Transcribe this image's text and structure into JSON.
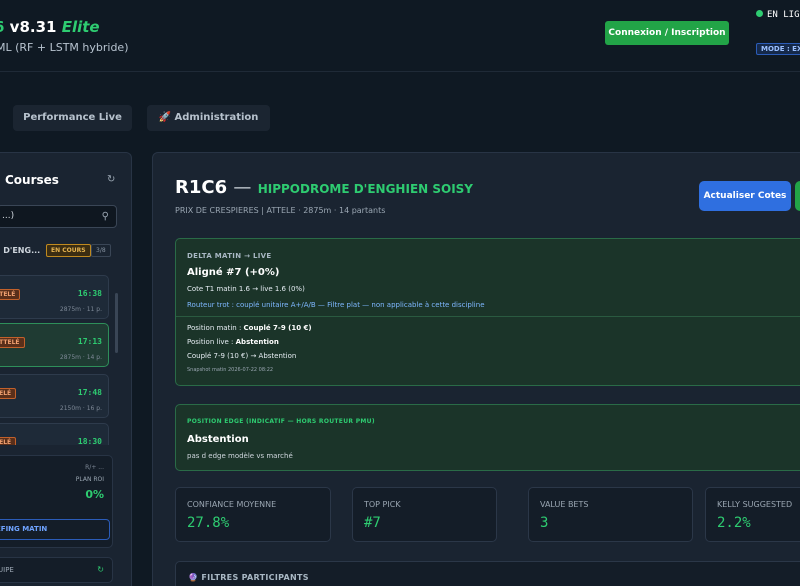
{
  "header": {
    "brand_prefix": "6",
    "version": "v8.31",
    "edition": "Elite",
    "subtitle": "ML (RF + LSTM hybride)",
    "login_label": "Connexion / Inscription",
    "status_label": "EN LIG",
    "mode_label": "MODE : EX",
    "status_color": "#2ecc71"
  },
  "tabs": [
    {
      "label": "Performance Live"
    },
    {
      "label": "🚀 Administration"
    }
  ],
  "sidebar": {
    "title": "Courses",
    "search_value": "...)",
    "meeting": {
      "name": "E D'ENG...",
      "status": "EN COURS",
      "count": "3/8"
    },
    "races": [
      {
        "discipline": "TTELÉ",
        "time": "16:38",
        "meta": "2875m · 11 p."
      },
      {
        "discipline": "ATTELÉ",
        "time": "17:13",
        "meta": "2875m · 14 p."
      },
      {
        "discipline": "TELÉ",
        "time": "17:48",
        "meta": "2150m · 16 p."
      },
      {
        "discipline": "TELÉ",
        "time": "18:30",
        "meta": ""
      }
    ],
    "stats": {
      "line1": "R/+ ...",
      "line2": "PLAN ROI",
      "pct": "0%"
    },
    "briefing_label": "EFING MATIN",
    "team_label": "UIPE"
  },
  "race": {
    "code": "R1C6",
    "hippodrome": "HIPPODROME D'ENGHIEN SOISY",
    "info": "PRIX DE CRESPIERES | ATTELE · 2875m · 14 partants",
    "refresh_label": "Actualiser Cotes"
  },
  "delta": {
    "label": "DELTA MATIN → LIVE",
    "aligned": "Aligné #7 (+0%)",
    "cote": "Cote T1 matin 1.6 → live 1.6 (0%)",
    "routeur": "Routeur trot : couplé unitaire A+/A/B — Filtre plat — non applicable à cette discipline",
    "pos_matin_label": "Position matin : ",
    "pos_matin_value": "Couplé 7-9 (10 €)",
    "pos_live_label": "Position live : ",
    "pos_live_value": "Abstention",
    "change": "Couplé 7-9 (10 €) → Abstention",
    "snapshot": "Snapshot matin 2026-07-22 08:22"
  },
  "edge": {
    "label": "POSITION EDGE (INDICATIF — HORS ROUTEUR PMU)",
    "title": "Abstention",
    "desc": "pas d edge modèle vs marché"
  },
  "metrics": [
    {
      "label": "CONFIANCE MOYENNE",
      "value": "27.8%"
    },
    {
      "label": "TOP PICK",
      "value": "#7"
    },
    {
      "label": "VALUE BETS",
      "value": "3"
    },
    {
      "label": "KELLY SUGGESTED",
      "value": "2.2%"
    }
  ],
  "filters": {
    "label": "🔮 FILTRES PARTICIPANTS"
  }
}
